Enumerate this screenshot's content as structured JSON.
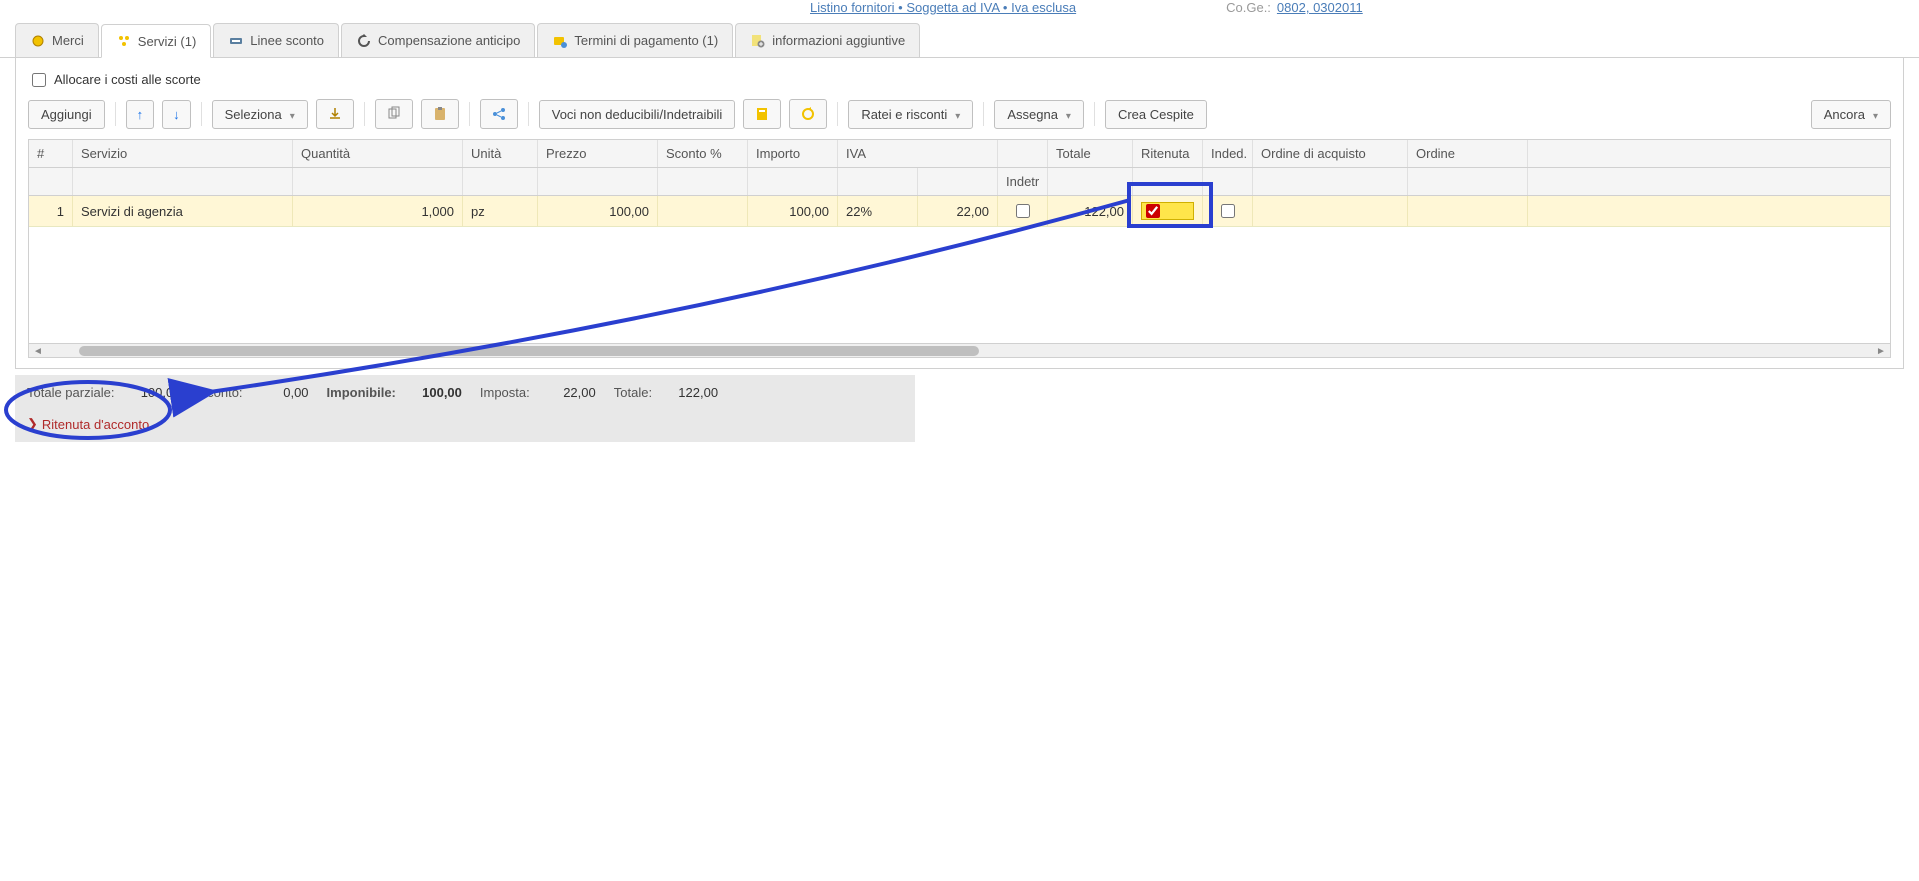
{
  "header": {
    "link_left": "Listino fornitori • Soggetta ad IVA • Iva esclusa",
    "coge_label": "Co.Ge.:",
    "coge_val": "0802, 0302011"
  },
  "tabs": {
    "merci": "Merci",
    "servizi": "Servizi (1)",
    "linee_sconto": "Linee sconto",
    "comp_anticipo": "Compensazione anticipo",
    "termini": "Termini di pagamento (1)",
    "info_agg": "informazioni aggiuntive"
  },
  "allocate_label": "Allocare i costi alle scorte",
  "toolbar": {
    "aggiungi": "Aggiungi",
    "seleziona": "Seleziona",
    "voci": "Voci non deducibili/Indetraibili",
    "ratei": "Ratei e risconti",
    "assegna": "Assegna",
    "crea_cespite": "Crea Cespite",
    "ancora": "Ancora"
  },
  "columns": {
    "n": "#",
    "servizio": "Servizio",
    "quantita": "Quantità",
    "unita": "Unità",
    "prezzo": "Prezzo",
    "sconto": "Sconto %",
    "importo": "Importo",
    "iva": "IVA",
    "indetr": "Indetr",
    "totale": "Totale",
    "ritenuta": "Ritenuta",
    "inded": "Inded.",
    "ordine_acq": "Ordine di acquisto",
    "ordine": "Ordine"
  },
  "row": {
    "n": "1",
    "servizio": "Servizi di agenzia",
    "quantita": "1,000",
    "unita": "pz",
    "prezzo": "100,00",
    "sconto": "",
    "importo": "100,00",
    "iva": "22%",
    "iva_amt": "22,00",
    "totale": "122,00"
  },
  "totals": {
    "totale_parziale_lbl": "Totale parziale:",
    "totale_parziale": "100,00",
    "sconto_lbl": "Sconto:",
    "sconto": "0,00",
    "imponibile_lbl": "Imponibile:",
    "imponibile": "100,00",
    "imposta_lbl": "Imposta:",
    "imposta": "22,00",
    "totale_lbl": "Totale:",
    "totale": "122,00"
  },
  "ritenuta_link": "Ritenuta d'acconto"
}
